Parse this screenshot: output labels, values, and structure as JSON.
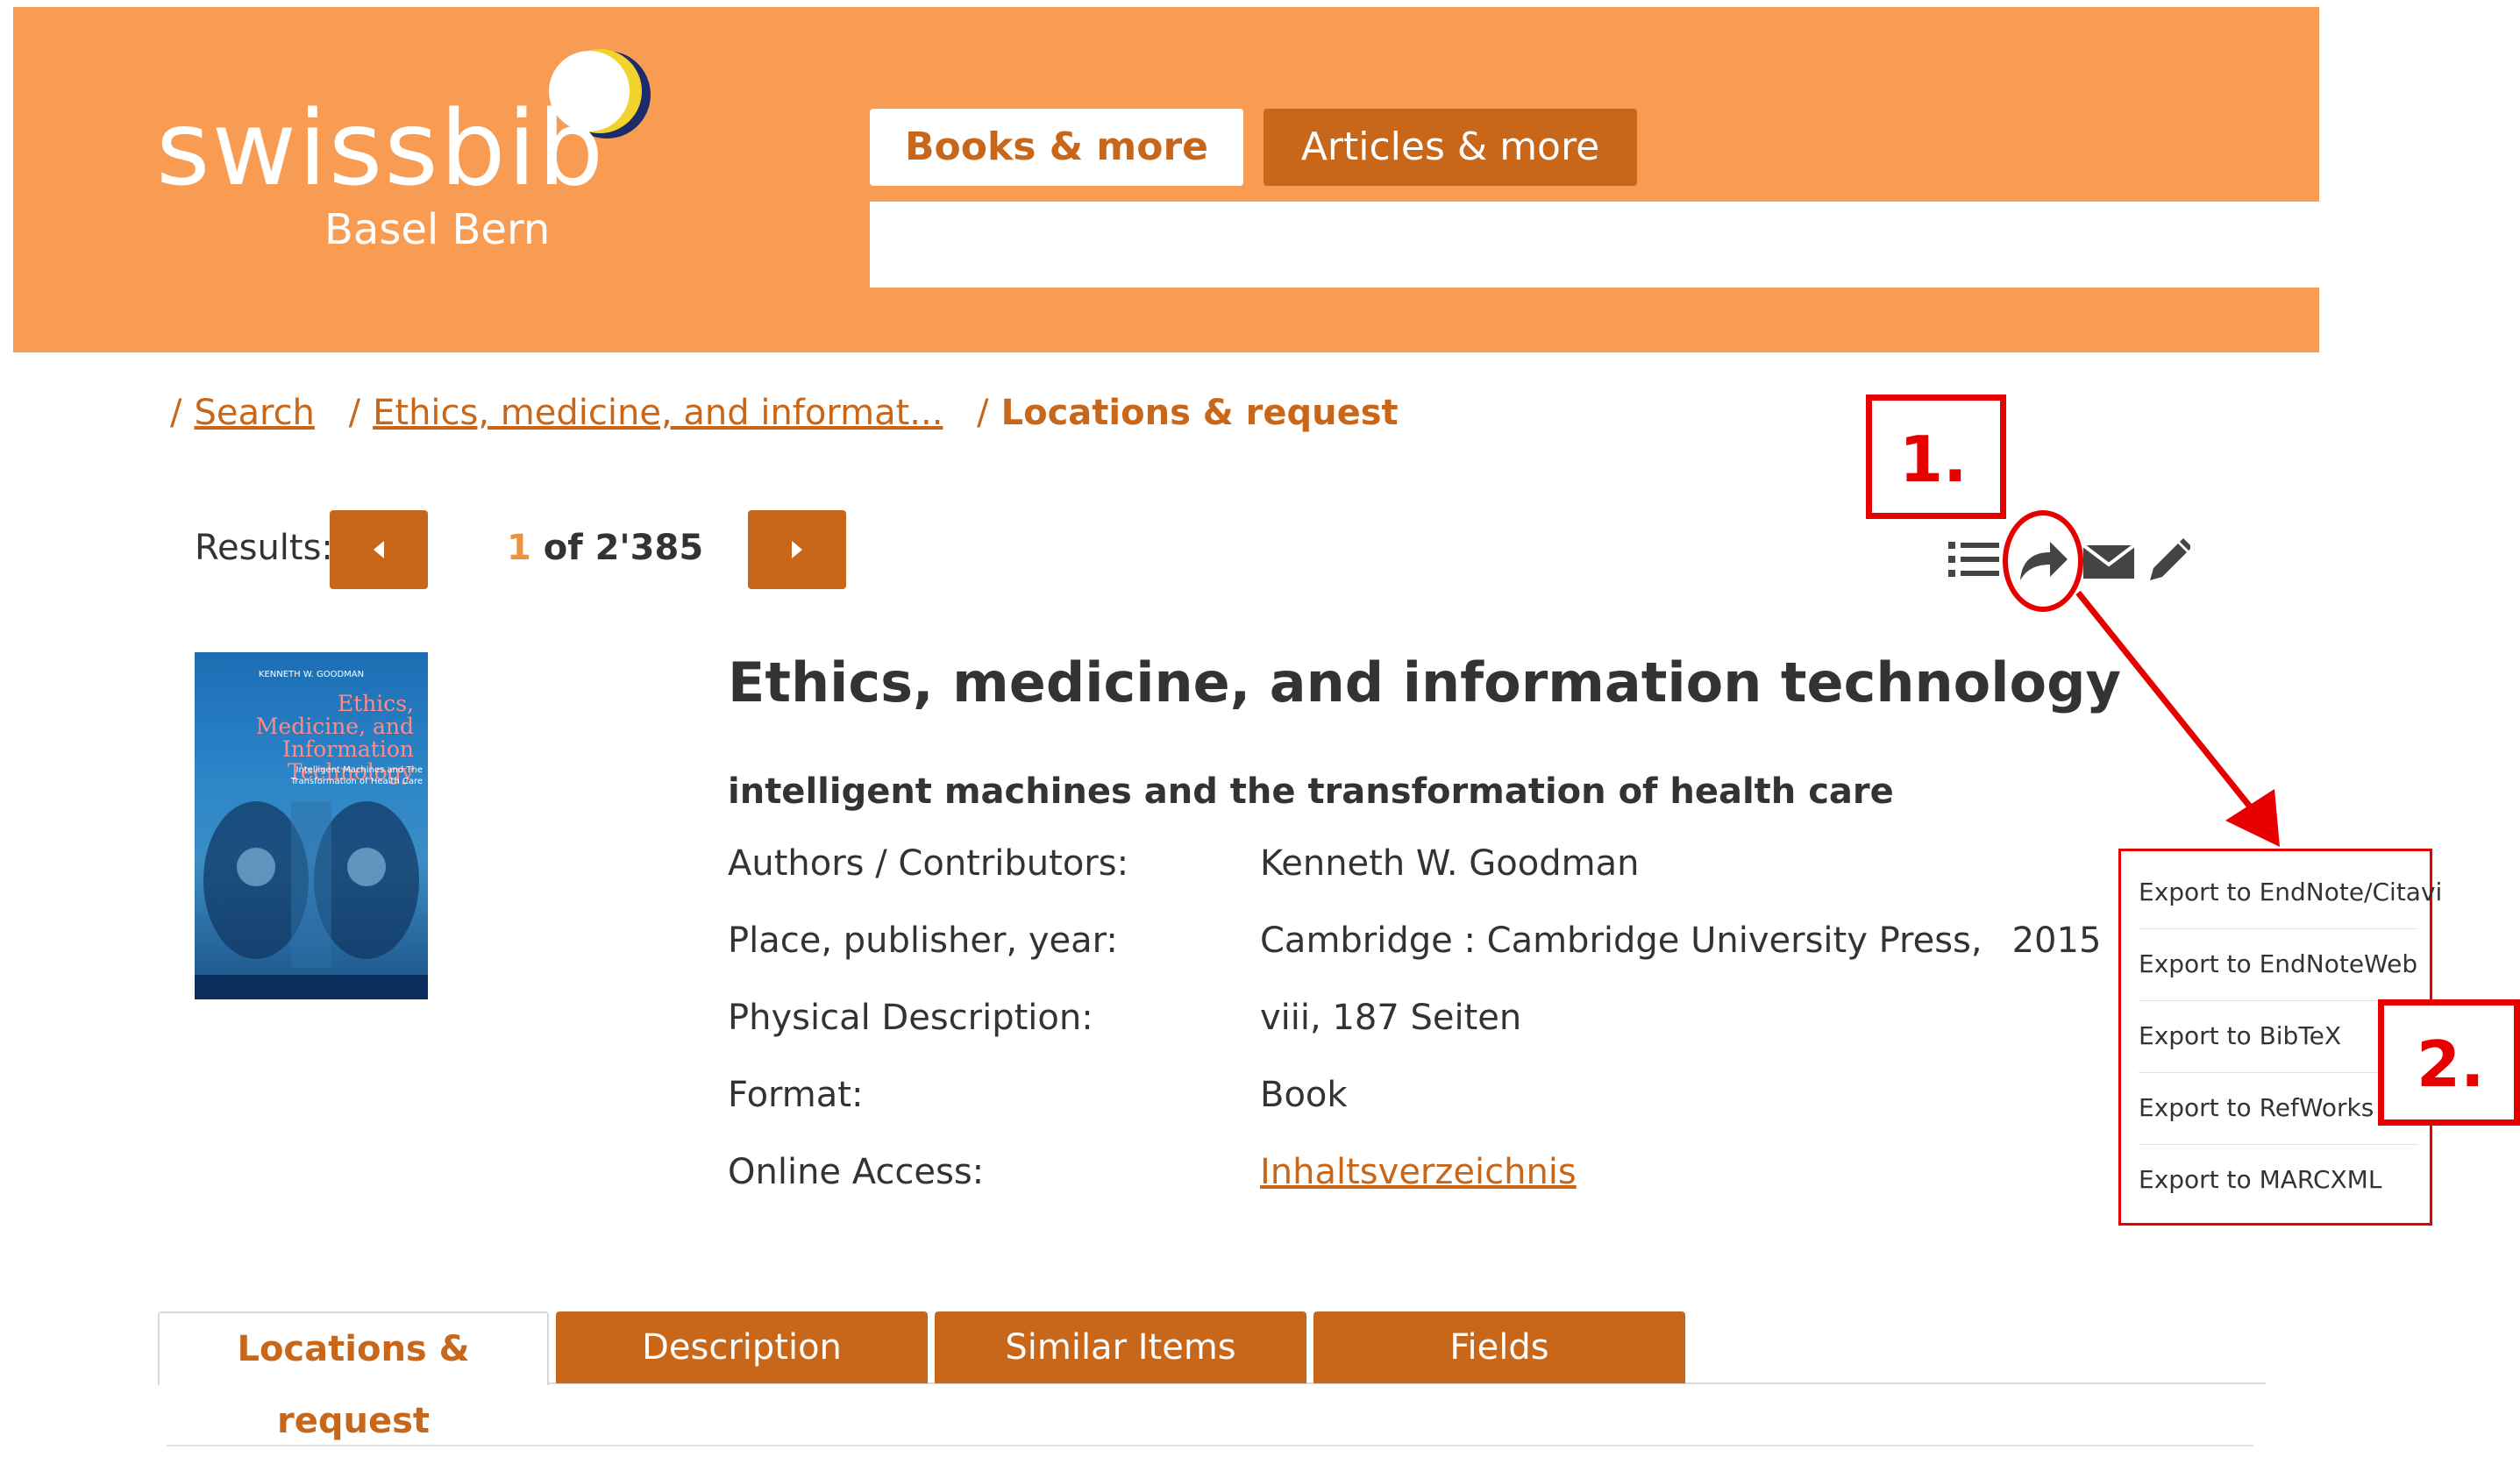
{
  "header": {
    "logo_text": "swissbib",
    "logo_sub": "Basel Bern",
    "tabs": [
      {
        "label": "Books & more",
        "active": true
      },
      {
        "label": "Articles & more",
        "active": false
      }
    ],
    "colors": {
      "header_bg": "#f89c53",
      "accent": "#c8661a"
    }
  },
  "breadcrumb": {
    "sep": "/",
    "items": [
      "Search",
      "Ethics, medicine, and informat...",
      "Locations & request"
    ]
  },
  "results": {
    "label": "Results:",
    "current": "1",
    "total_text": "of 2'385"
  },
  "actions": {
    "icons": [
      "list-icon",
      "share-icon",
      "mail-icon",
      "pencil-icon"
    ]
  },
  "annotations": {
    "step1": "1.",
    "step2": "2.",
    "color": "#e60000"
  },
  "cover": {
    "author": "KENNETH W. GOODMAN",
    "title": "Ethics, Medicine, and Information Technology",
    "subtitle": "Intelligent Machines and The Transformation of Health Care"
  },
  "record": {
    "title": "Ethics, medicine, and information technology",
    "subtitle": "intelligent machines and the transformation of health care",
    "rows": [
      {
        "label": "Authors / Contributors:",
        "value": "Kenneth W. Goodman"
      },
      {
        "label": "Place, publisher, year:",
        "value": "Cambridge :  Cambridge University Press,",
        "year": "2015"
      },
      {
        "label": "Physical Description:",
        "value": "viii, 187 Seiten"
      },
      {
        "label": "Format:",
        "value": "Book"
      },
      {
        "label": "Online Access:",
        "value": "Inhaltsverzeichnis"
      }
    ]
  },
  "export_menu": {
    "items": [
      "Export to EndNote/Citavi",
      "Export to EndNoteWeb",
      "Export to BibTeX",
      "Export to RefWorks",
      "Export to MARCXML"
    ]
  },
  "bottom_tabs": [
    {
      "label": "Locations & request",
      "active": true
    },
    {
      "label": "Description",
      "active": false
    },
    {
      "label": "Similar Items",
      "active": false
    },
    {
      "label": "Fields",
      "active": false
    }
  ]
}
